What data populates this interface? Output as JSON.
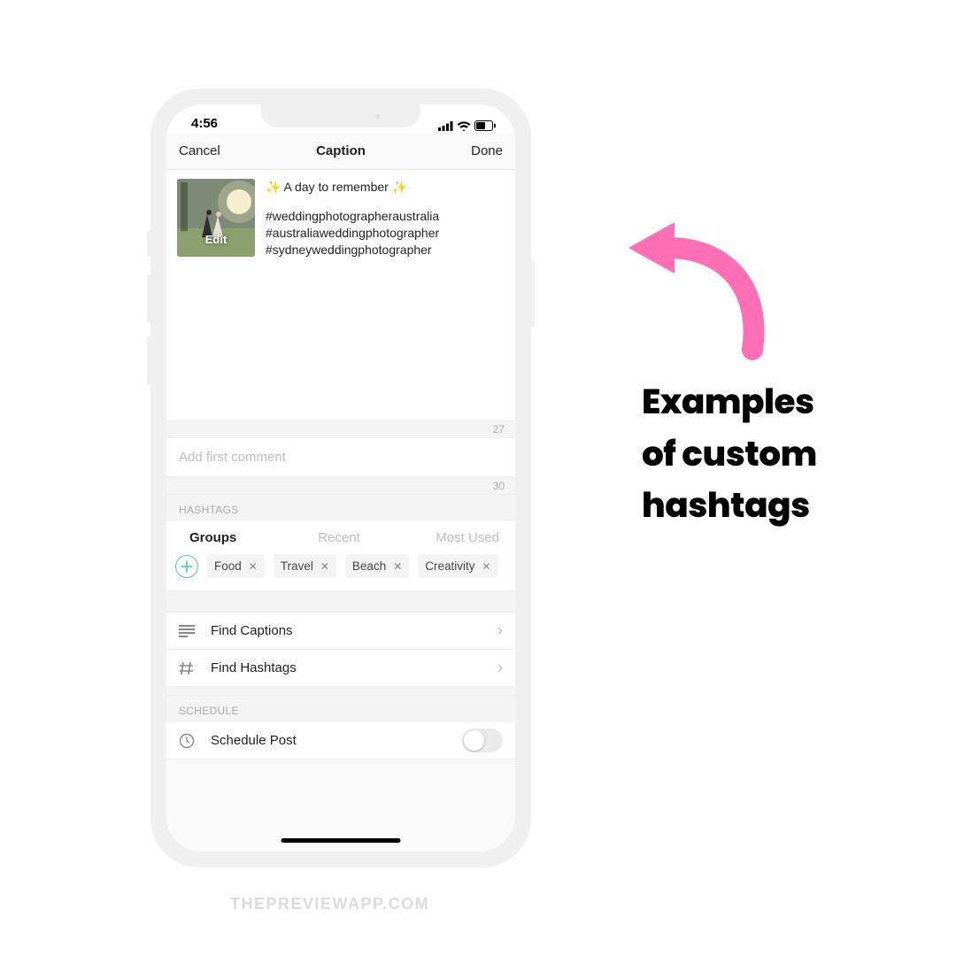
{
  "status": {
    "time": "4:56"
  },
  "nav": {
    "cancel": "Cancel",
    "title": "Caption",
    "done": "Done"
  },
  "caption": {
    "edit_label": "Edit",
    "line1": "✨ A day to remember ✨",
    "hashtag1": "#weddingphotographeraustralia",
    "hashtag2": "#australiaweddingphotographer",
    "hashtag3": "#sydneyweddingphotographer",
    "count": "27"
  },
  "comment": {
    "placeholder": "Add first comment",
    "count": "30"
  },
  "sections": {
    "hashtags": "HASHTAGS",
    "schedule": "SCHEDULE"
  },
  "tabs": {
    "groups": "Groups",
    "recent": "Recent",
    "most_used": "Most Used"
  },
  "chips": {
    "c1": "Food",
    "c2": "Travel",
    "c3": "Beach",
    "c4": "Creativity"
  },
  "rows": {
    "find_captions": "Find Captions",
    "find_hashtags": "Find Hashtags",
    "schedule_post": "Schedule Post"
  },
  "annotation": {
    "line1": "Examples",
    "line2": "of custom",
    "line3": "hashtags"
  },
  "watermark": "THEPREVIEWAPP.COM",
  "colors": {
    "accent_pink": "#ff6fb5",
    "accent_teal": "#4fbcd6"
  }
}
